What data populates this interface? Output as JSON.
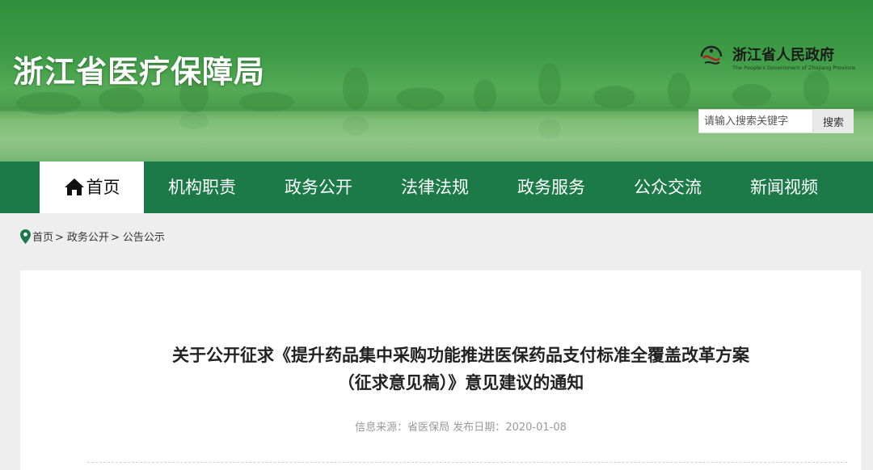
{
  "header": {
    "site_title": "浙江省医疗保障局",
    "gov_logo": {
      "name": "浙江省人民政府",
      "subtitle": "The People's Government of Zhejiang Province",
      "icon": "zhejiang-gov-emblem"
    },
    "search": {
      "placeholder": "请输入搜索关键字",
      "button_label": "搜索"
    }
  },
  "nav": {
    "items": [
      {
        "label": "首页",
        "icon": "home-icon",
        "active": true
      },
      {
        "label": "机构职责"
      },
      {
        "label": "政务公开"
      },
      {
        "label": "法律法规"
      },
      {
        "label": "政务服务"
      },
      {
        "label": "公众交流"
      },
      {
        "label": "新闻视频"
      }
    ]
  },
  "breadcrumb": {
    "icon": "location-pin-icon",
    "items": [
      "首页",
      "政务公开",
      "公告公示"
    ],
    "separator": ">"
  },
  "article": {
    "title_line1": "关于公开征求《提升药品集中采购功能推进医保药品支付标准全覆盖改革方案",
    "title_line2": "（征求意见稿）》意见建议的通知",
    "source_label": "信息来源：",
    "source": "省医保局",
    "date_label": "发布日期：",
    "date": "2020-01-08"
  },
  "colors": {
    "nav_bg": "#1b7a48",
    "header_green": "#3e9c47",
    "page_bg": "#eeeeee",
    "accent_pin": "#1b7a48"
  }
}
